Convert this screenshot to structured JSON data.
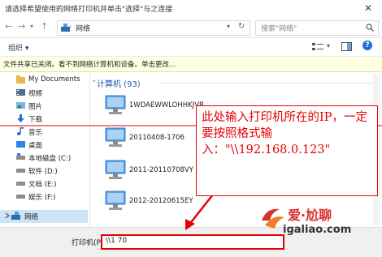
{
  "window": {
    "title": "请选择希望使用的网络打印机并单击\"选择\"与之连接"
  },
  "nav": {
    "address": "网络",
    "search_placeholder": "搜索\"网络\""
  },
  "toolbar": {
    "organize": "组织 ▾"
  },
  "infobar": {
    "text": "文件共享已关闭。看不到网络计算机和设备。单击更改..."
  },
  "sidebar": {
    "items": [
      {
        "label": "My Documents",
        "icon": "folder-icon"
      },
      {
        "label": "视频",
        "icon": "video-icon"
      },
      {
        "label": "图片",
        "icon": "pictures-icon"
      },
      {
        "label": "下载",
        "icon": "download-icon"
      },
      {
        "label": "音乐",
        "icon": "music-icon"
      },
      {
        "label": "桌面",
        "icon": "desktop-icon"
      },
      {
        "label": "本地磁盘 (C:)",
        "icon": "drive-icon"
      },
      {
        "label": "软件 (D:)",
        "icon": "drive-icon"
      },
      {
        "label": "文档 (E:)",
        "icon": "drive-icon"
      },
      {
        "label": "娱乐 (F:)",
        "icon": "drive-icon"
      },
      {
        "label": "网络",
        "icon": "network-icon"
      }
    ]
  },
  "main": {
    "group_header": "计算机 (93)",
    "computers": [
      "1WDAEWWLOHHKJVB",
      "20110408-1706",
      "2011-20110708VY",
      "2012-20120615EY"
    ]
  },
  "bottom": {
    "printer_label": "打印机(P):",
    "printer_value": "\\\\1         70"
  },
  "annotation": {
    "text": "此处输入打印机所在的IP，一定要按照格式输入：\"\\\\192.168.0.123\""
  },
  "logo": {
    "name": "爱·尬聊",
    "url": "igaliao.com"
  },
  "colors": {
    "accent": "#1e5aa8",
    "annotation": "#e60000",
    "infobar_bg": "#ffffe1"
  }
}
